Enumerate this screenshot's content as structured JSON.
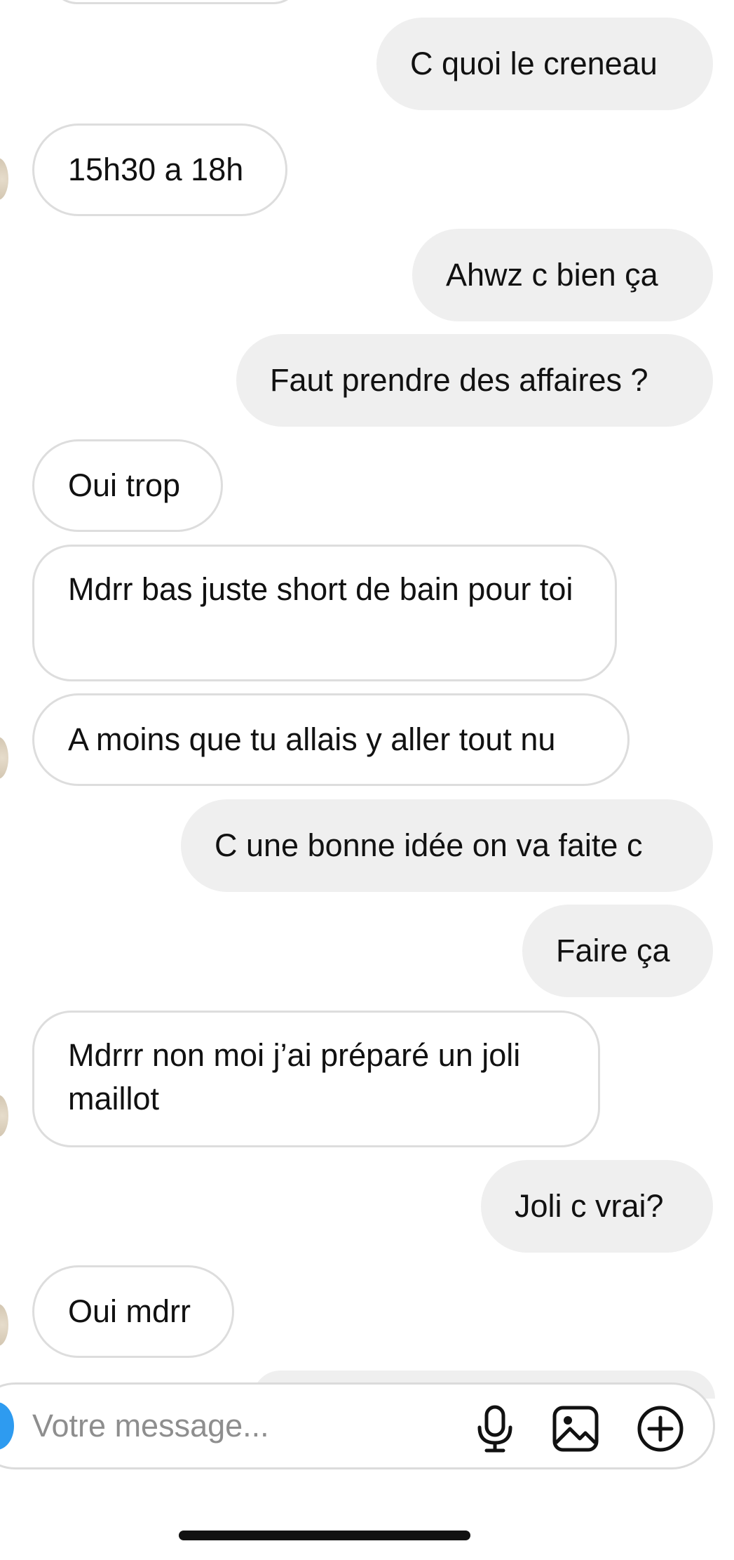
{
  "messages": [
    {
      "side": "sent",
      "text": "C quoi le creneau"
    },
    {
      "side": "received",
      "text": "15h30 a 18h"
    },
    {
      "side": "sent",
      "text": "Ahwz c bien ça"
    },
    {
      "side": "sent",
      "text": "Faut prendre des affaires ?"
    },
    {
      "side": "received",
      "text": "Oui trop"
    },
    {
      "side": "received",
      "text": "Mdrr bas juste short de bain pour toi"
    },
    {
      "side": "received",
      "text": "A moins que tu allais y aller tout nu"
    },
    {
      "side": "sent",
      "text": "C une bonne idée on va faite c"
    },
    {
      "side": "sent",
      "text": "Faire ça"
    },
    {
      "side": "received",
      "text": "Mdrrr non moi j’ai préparé un joli maillot"
    },
    {
      "side": "sent",
      "text": "Joli c vrai?"
    },
    {
      "side": "received",
      "text": "Oui mdrr"
    }
  ],
  "composer": {
    "placeholder": "Votre message...",
    "icons": [
      "microphone-icon",
      "image-icon",
      "plus-circle-icon"
    ]
  },
  "colors": {
    "sent_bubble": "#efefef",
    "received_border": "#dddddd",
    "text": "#111111",
    "placeholder": "#8e8e8e",
    "accent": "#2e9bf0"
  }
}
